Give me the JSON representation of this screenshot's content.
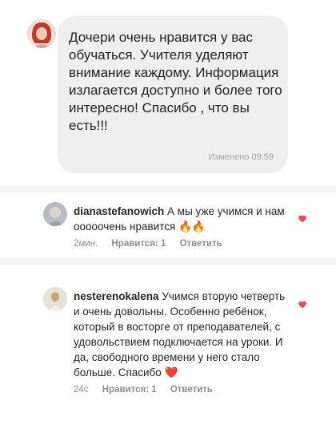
{
  "message": {
    "text": "Дочери очень нравится у вас обучаться. Учителя уделяют внимание каждому. Информация излагается доступно и более того интересно! Спасибо , что вы есть!!!",
    "edited_label": "Изменено 09:59"
  },
  "comments": [
    {
      "username": "dianastefanowich",
      "text": "А мы уже учимся и нам ооооочень нравится",
      "emoji": "🔥🔥",
      "time": "2мин.",
      "likes": "Нравится: 1",
      "reply": "Ответить"
    },
    {
      "username": "nesterenokalena",
      "text": "Учимся вторую четверть и очень довольны. Особенно ребёнок, который в восторге от преподавателей, с удовольствием подключается на уроки. И да, свободного времени у него стало больше. Спасибо",
      "emoji": "❤️",
      "time": "24с",
      "likes": "Нравится: 1",
      "reply": "Ответить"
    }
  ],
  "colors": {
    "heart": "#e84a5f",
    "bubble": "#efefef",
    "meta": "#8e8e8e"
  },
  "icons": [
    "like-heart-icon",
    "fire-emoji-icon",
    "red-heart-emoji-icon"
  ]
}
